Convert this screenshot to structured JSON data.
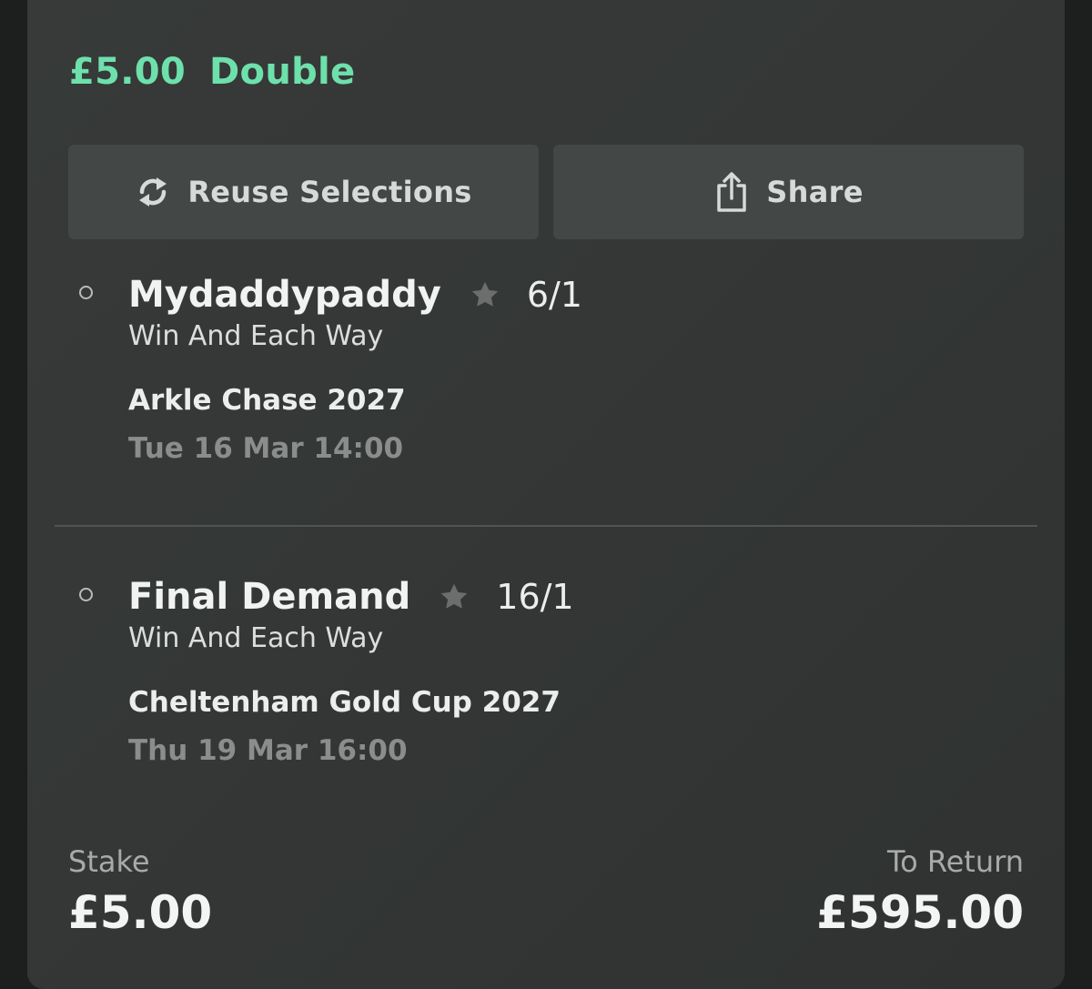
{
  "bet": {
    "stake_amount": "£5.00",
    "bet_type": "Double"
  },
  "actions": {
    "reuse_label": "Reuse Selections",
    "reuse_icon": "refresh-icon",
    "share_label": "Share",
    "share_icon": "share-icon"
  },
  "selections": [
    {
      "horse": "Mydaddypaddy",
      "odds": "6/1",
      "market": "Win And Each Way",
      "event": "Arkle Chase 2027",
      "datetime": "Tue 16 Mar 14:00",
      "star_icon": "star-icon"
    },
    {
      "horse": "Final Demand",
      "odds": "16/1",
      "market": "Win And Each Way",
      "event": "Cheltenham Gold Cup 2027",
      "datetime": "Thu 19 Mar 16:00",
      "star_icon": "star-icon"
    }
  ],
  "footer": {
    "stake_label": "Stake",
    "stake_value": "£5.00",
    "return_label": "To Return",
    "return_value": "£595.00"
  },
  "colors": {
    "accent_green": "#6ee0ac",
    "card_bg": "#363938",
    "button_bg": "#434745",
    "page_bg": "#1d1e1e"
  }
}
